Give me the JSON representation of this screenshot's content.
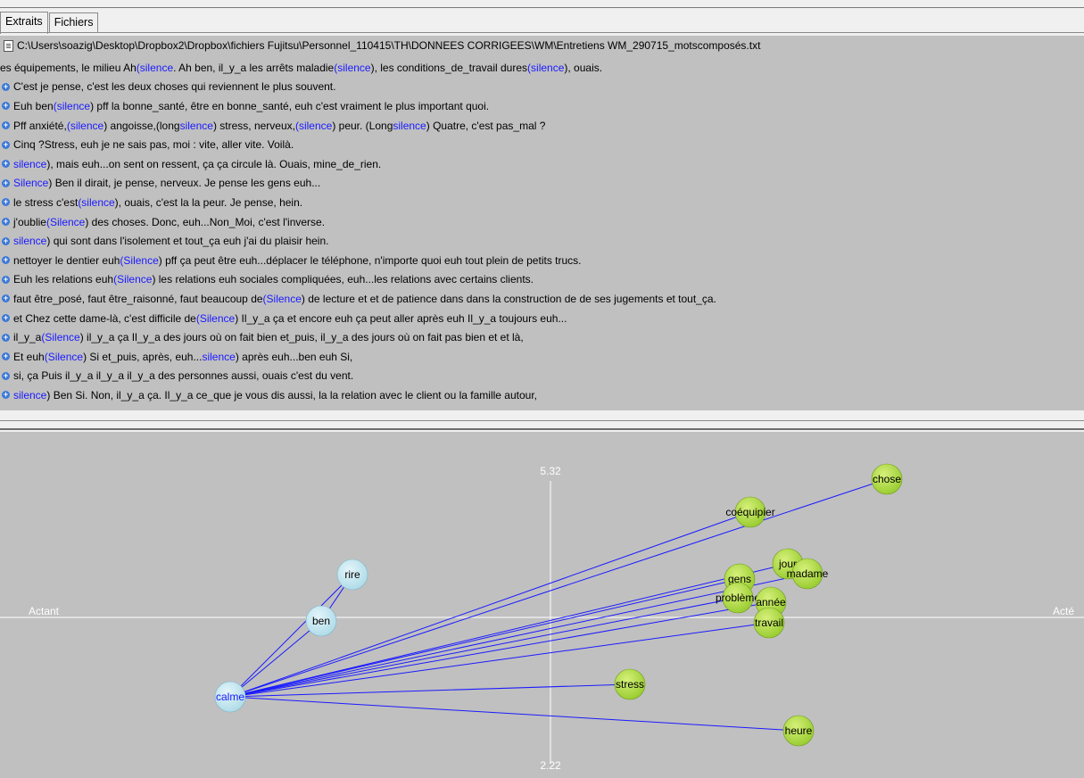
{
  "tabs": [
    "Extraits",
    "Fichiers"
  ],
  "extracts": {
    "file_path": "C:\\Users\\soazig\\Desktop\\Dropbox2\\Dropbox\\fichiers Fujitsu\\Personnel_110415\\TH\\DONNEES CORRIGEES\\WM\\Entretiens WM_290715_motscomposés.txt",
    "lines": [
      {
        "marker": false,
        "parts": [
          {
            "t": "es équipements, le milieu Ah "
          },
          {
            "t": "(silence",
            "h": true
          },
          {
            "t": ". Ah ben, il_y_a les arrêts maladie "
          },
          {
            "t": "(silence",
            "h": true
          },
          {
            "t": "), les conditions_de_travail dures "
          },
          {
            "t": "(silence",
            "h": true
          },
          {
            "t": "), ouais."
          }
        ]
      },
      {
        "marker": true,
        "parts": [
          {
            "t": "C'est je pense,  c'est les deux choses  qui reviennent le plus souvent."
          }
        ]
      },
      {
        "marker": true,
        "parts": [
          {
            "t": "Euh ben "
          },
          {
            "t": "(silence",
            "h": true
          },
          {
            "t": ") pff la bonne_santé, être en bonne_santé,  euh c'est vraiment le plus important quoi."
          }
        ]
      },
      {
        "marker": true,
        "parts": [
          {
            "t": "Pff anxiété,"
          },
          {
            "t": "(silence",
            "h": true
          },
          {
            "t": ") angoisse,(long "
          },
          {
            "t": "silence",
            "h": true
          },
          {
            "t": ") stress, nerveux,"
          },
          {
            "t": "(silence",
            "h": true
          },
          {
            "t": ") peur. (Long "
          },
          {
            "t": "silence",
            "h": true
          },
          {
            "t": ") Quatre, c'est pas_mal ?"
          }
        ]
      },
      {
        "marker": true,
        "parts": [
          {
            "t": "Cinq ?Stress, euh je ne sais pas, moi : vite, aller vite. Voilà."
          }
        ]
      },
      {
        "marker": true,
        "parts": [
          {
            "t": "silence",
            "h": true
          },
          {
            "t": "), mais euh...on sent on ressent,  ça ça circule là. Ouais, mine_de_rien."
          }
        ]
      },
      {
        "marker": true,
        "parts": [
          {
            "t": "Silence",
            "h": true
          },
          {
            "t": ") Ben il dirait,  je pense, nerveux. Je pense les gens euh..."
          }
        ]
      },
      {
        "marker": true,
        "parts": [
          {
            "t": "le stress c'est "
          },
          {
            "t": "(silence",
            "h": true
          },
          {
            "t": "), ouais,  c'est la la peur. Je pense, hein."
          }
        ]
      },
      {
        "marker": true,
        "parts": [
          {
            "t": " j'oublie "
          },
          {
            "t": "(Silence",
            "h": true
          },
          {
            "t": ") des choses. Donc, euh...Non_Moi, c'est l'inverse."
          }
        ]
      },
      {
        "marker": true,
        "parts": [
          {
            "t": "silence",
            "h": true
          },
          {
            "t": ") qui sont dans l'isolement et tout_ça euh  j'ai du plaisir hein."
          }
        ]
      },
      {
        "marker": true,
        "parts": [
          {
            "t": "nettoyer le dentier euh "
          },
          {
            "t": "(Silence",
            "h": true
          },
          {
            "t": ") pff ça peut être euh...déplacer le téléphone, n'importe quoi euh tout plein de petits trucs."
          }
        ]
      },
      {
        "marker": true,
        "parts": [
          {
            "t": "Euh les relations euh "
          },
          {
            "t": "(Silence",
            "h": true
          },
          {
            "t": ") les relations euh sociales compliquées, euh...les relations avec certains clients."
          }
        ]
      },
      {
        "marker": true,
        "parts": [
          {
            "t": " faut être_posé, faut être_raisonné, faut beaucoup de "
          },
          {
            "t": "(Silence",
            "h": true
          },
          {
            "t": ") de lecture et et de patience dans dans la construction de de ses jugements et tout_ça."
          }
        ]
      },
      {
        "marker": true,
        "parts": [
          {
            "t": " et Chez cette dame-là, c'est difficile de "
          },
          {
            "t": "(Silence",
            "h": true
          },
          {
            "t": ") Il_y_a ça  et encore euh ça peut aller après euh Il_y_a toujours euh..."
          }
        ]
      },
      {
        "marker": true,
        "parts": [
          {
            "t": "il_y_a "
          },
          {
            "t": "(Silence",
            "h": true
          },
          {
            "t": ") il_y_a ça Il_y_a des jours où on fait bien  et_puis, il_y_a des jours où on fait pas bien et et là,"
          }
        ]
      },
      {
        "marker": true,
        "parts": [
          {
            "t": "Et euh "
          },
          {
            "t": "(Silence",
            "h": true
          },
          {
            "t": ") Si et_puis, après, euh..."
          },
          {
            "t": "silence",
            "h": true
          },
          {
            "t": ") après euh...ben euh Si,"
          }
        ]
      },
      {
        "marker": true,
        "parts": [
          {
            "t": " si, ça Puis il_y_a il_y_a il_y_a des personnes aussi,  ouais c'est du vent."
          }
        ]
      },
      {
        "marker": true,
        "parts": [
          {
            "t": "silence",
            "h": true
          },
          {
            "t": ") Ben Si. Non, il_y_a ça. Il_y_a ce_que je vous dis aussi, la la relation avec le client ou la famille autour,"
          }
        ]
      }
    ]
  },
  "graph": {
    "y_top_label": "5.32",
    "y_bottom_label": "2.22",
    "x_left_label": "Actant",
    "x_right_label": "Acté",
    "colors": {
      "line": "#1a1aff",
      "green": "#9acd32",
      "blue": "#b0dce8",
      "axis": "#ffffff"
    },
    "hub": "calme",
    "left_words": [
      "rire",
      "ben",
      "calme"
    ],
    "right_words": [
      "chose",
      "coéquipier",
      "jour",
      "madame",
      "gens",
      "problème",
      "année",
      "travail",
      "stress",
      "heure"
    ],
    "links": [
      "rire|ben",
      "ben|calme",
      "rire|calme",
      "calme|chose",
      "calme|coéquipier",
      "calme|jour",
      "calme|madame",
      "calme|gens",
      "calme|problème",
      "calme|année",
      "calme|travail",
      "calme|stress",
      "calme|heure"
    ]
  }
}
